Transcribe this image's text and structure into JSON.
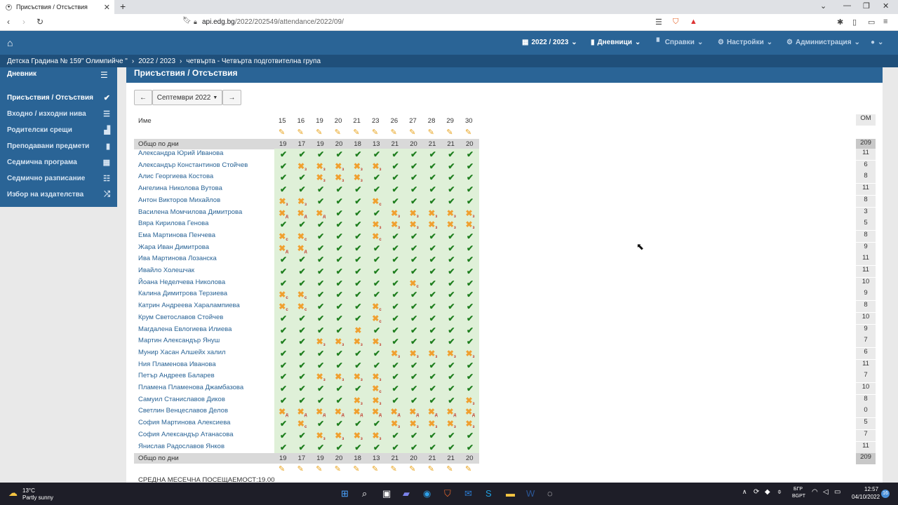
{
  "browser": {
    "tab_title": "Присъствия / Отсъствия",
    "url_host": "api.edg.bg",
    "url_path": "/2022/202549/attendance/2022/09/"
  },
  "appbar": {
    "year": "2022 / 2023",
    "diaries": "Дневници",
    "reports": "Справки",
    "settings": "Настройки",
    "admin": "Администрация"
  },
  "breadcrumb": {
    "school": "Детска Градина № 159\" Олимпийче \"",
    "year": "2022 / 2023",
    "group": "четвърта - Четвърта подготвителна група"
  },
  "sidebar": {
    "header": "Дневник",
    "items": [
      "Присъствия / Отсъствия",
      "Входно / изходни нива",
      "Родителски срещи",
      "Преподавани предмети",
      "Седмична програма",
      "Седмично разписание",
      "Избор на издателства"
    ]
  },
  "page": {
    "title": "Присъствия / Отсъствия",
    "month": "Септември 2022",
    "name_header": "Име",
    "om_header": "ОМ",
    "totals_label": "Общо по дни",
    "avg_label": "СРЕДНА МЕСЕЧНА ПОСЕЩАЕМОСТ:19.00"
  },
  "days": [
    "15",
    "16",
    "19",
    "20",
    "21",
    "23",
    "26",
    "27",
    "28",
    "29",
    "30"
  ],
  "day_totals": [
    "19",
    "17",
    "19",
    "20",
    "18",
    "13",
    "21",
    "20",
    "21",
    "21",
    "20"
  ],
  "om_total": "209",
  "rows": [
    {
      "name": "Александра Юрий Иванова",
      "c": [
        "v",
        "v",
        "v",
        "v",
        "v",
        "v",
        "v",
        "v",
        "v",
        "v",
        "v"
      ],
      "om": "11"
    },
    {
      "name": "Александър Константинов Стойчев",
      "c": [
        "v",
        "з",
        "з",
        "з",
        "з",
        "з",
        "v",
        "v",
        "v",
        "v",
        "v"
      ],
      "om": "6"
    },
    {
      "name": "Алис Георгиева Костова",
      "c": [
        "v",
        "v",
        "з",
        "з",
        "з",
        "v",
        "v",
        "v",
        "v",
        "v",
        "v"
      ],
      "om": "8"
    },
    {
      "name": "Ангелина Николова Вутова",
      "c": [
        "v",
        "v",
        "v",
        "v",
        "v",
        "v",
        "v",
        "v",
        "v",
        "v",
        "v"
      ],
      "om": "11"
    },
    {
      "name": "Антон Викторов Михайлов",
      "c": [
        "з",
        "з",
        "v",
        "v",
        "v",
        "с",
        "v",
        "v",
        "v",
        "v",
        "v"
      ],
      "om": "8"
    },
    {
      "name": "Василена Момчилова Димитрова",
      "c": [
        "д",
        "д",
        "д",
        "v",
        "v",
        "v",
        "з",
        "з",
        "з",
        "з",
        "з"
      ],
      "om": "3"
    },
    {
      "name": "Вяра Кирилова Генова",
      "c": [
        "v",
        "v",
        "v",
        "v",
        "v",
        "з",
        "з",
        "з",
        "з",
        "з",
        "з"
      ],
      "om": "5"
    },
    {
      "name": "Ема Мартинова Пенчева",
      "c": [
        "с",
        "с",
        "v",
        "v",
        "v",
        "с",
        "v",
        "v",
        "v",
        "v",
        "v"
      ],
      "om": "8"
    },
    {
      "name": "Жара Иван Димитрова",
      "c": [
        "д",
        "д",
        "v",
        "v",
        "v",
        "v",
        "v",
        "v",
        "v",
        "v",
        "v"
      ],
      "om": "9"
    },
    {
      "name": "Ива Мартинова Лозанска",
      "c": [
        "v",
        "v",
        "v",
        "v",
        "v",
        "v",
        "v",
        "v",
        "v",
        "v",
        "v"
      ],
      "om": "11"
    },
    {
      "name": "Ивайло Холешчак",
      "c": [
        "v",
        "v",
        "v",
        "v",
        "v",
        "v",
        "v",
        "v",
        "v",
        "v",
        "v"
      ],
      "om": "11"
    },
    {
      "name": "Йоана Неделчева Николова",
      "c": [
        "v",
        "v",
        "v",
        "v",
        "v",
        "v",
        "v",
        "с",
        "v",
        "v",
        "v"
      ],
      "om": "10"
    },
    {
      "name": "Калина Димитрова Терзиева",
      "c": [
        "с",
        "с",
        "v",
        "v",
        "v",
        "v",
        "v",
        "v",
        "v",
        "v",
        "v"
      ],
      "om": "9"
    },
    {
      "name": "Катрин Андреева Харалампиева",
      "c": [
        "с",
        "с",
        "v",
        "v",
        "v",
        "с",
        "v",
        "v",
        "v",
        "v",
        "v"
      ],
      "om": "8"
    },
    {
      "name": "Крум Светославов Стойчев",
      "c": [
        "v",
        "v",
        "v",
        "v",
        "v",
        "с",
        "v",
        "v",
        "v",
        "v",
        "v"
      ],
      "om": "10"
    },
    {
      "name": "Магдалена Евлогиева Илиева",
      "c": [
        "v",
        "v",
        "v",
        "v",
        "x",
        "v",
        "v",
        "v",
        "v",
        "v",
        "v"
      ],
      "om": "9"
    },
    {
      "name": "Мартин Александър Януш",
      "c": [
        "v",
        "v",
        "з",
        "з",
        "з",
        "з",
        "v",
        "v",
        "v",
        "v",
        "v"
      ],
      "om": "7"
    },
    {
      "name": "Мунир Хасан Алшейх халил",
      "c": [
        "v",
        "v",
        "v",
        "v",
        "v",
        "v",
        "з",
        "з",
        "з",
        "з",
        "з"
      ],
      "om": "6"
    },
    {
      "name": "Ния Пламенова Иванова",
      "c": [
        "v",
        "v",
        "v",
        "v",
        "v",
        "v",
        "v",
        "v",
        "v",
        "v",
        "v"
      ],
      "om": "11"
    },
    {
      "name": "Петър Андреев Баларев",
      "c": [
        "v",
        "v",
        "з",
        "з",
        "з",
        "з",
        "v",
        "v",
        "v",
        "v",
        "v"
      ],
      "om": "7"
    },
    {
      "name": "Пламена Пламенова Джамбазова",
      "c": [
        "v",
        "v",
        "v",
        "v",
        "v",
        "с",
        "v",
        "v",
        "v",
        "v",
        "v"
      ],
      "om": "10"
    },
    {
      "name": "Самуил Станиславов Диков",
      "c": [
        "v",
        "v",
        "v",
        "v",
        "з",
        "з",
        "v",
        "v",
        "v",
        "v",
        "з"
      ],
      "om": "8"
    },
    {
      "name": "Светлин Венцеславов Делов",
      "c": [
        "д",
        "д",
        "д",
        "д",
        "д",
        "д",
        "д",
        "д",
        "д",
        "д",
        "д"
      ],
      "om": "0"
    },
    {
      "name": "София Мартинова Алексиева",
      "c": [
        "v",
        "с",
        "v",
        "v",
        "v",
        "v",
        "з",
        "з",
        "з",
        "з",
        "з"
      ],
      "om": "5"
    },
    {
      "name": "София Александър Атанасова",
      "c": [
        "v",
        "v",
        "з",
        "з",
        "з",
        "з",
        "v",
        "v",
        "v",
        "v",
        "v"
      ],
      "om": "7"
    },
    {
      "name": "Янислав Радославов Янков",
      "c": [
        "v",
        "v",
        "v",
        "v",
        "v",
        "v",
        "v",
        "v",
        "v",
        "v",
        "v"
      ],
      "om": "11"
    }
  ],
  "taskbar": {
    "temp": "13°C",
    "weather": "Partly sunny",
    "lang1": "БГР",
    "lang2": "BGPT",
    "time": "12:57",
    "date": "04/10/2022",
    "notif": "16"
  },
  "colors": {
    "brand": "#2a6496",
    "check": "#1e7e1e",
    "cross": "#f0a030",
    "cell_bg": "#dff0d8"
  }
}
